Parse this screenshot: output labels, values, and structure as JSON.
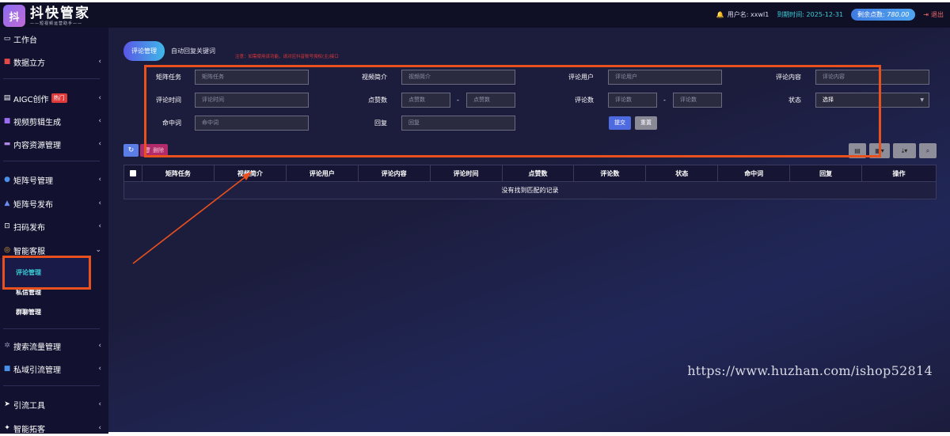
{
  "app": {
    "logo_mark": "抖",
    "title": "抖快管家",
    "subtitle": "——短视频运营助手——"
  },
  "header": {
    "bell_icon": "bell-icon",
    "user_label": "用户名: xxwl1",
    "expire_label": "到期时间: 2025-12-31",
    "points_label": "剩余点数:",
    "points_value": "780.00",
    "logout_label": "退出",
    "colors": {
      "expire": "#39d0d8",
      "logout": "#f06a6a",
      "points_bg": "#3f7be0"
    }
  },
  "sidebar": {
    "items": [
      {
        "label": "工作台",
        "icon": "monitor-icon"
      },
      {
        "label": "数据立方",
        "icon": "chart-icon"
      },
      {
        "label": "AIGC创作",
        "icon": "ai-icon",
        "badge": "热门"
      },
      {
        "label": "视频剪辑生成",
        "icon": "video-icon"
      },
      {
        "label": "内容资源管理",
        "icon": "folder-icon"
      },
      {
        "label": "矩阵号管理",
        "icon": "matrix-icon"
      },
      {
        "label": "矩阵号发布",
        "icon": "send-icon"
      },
      {
        "label": "扫码发布",
        "icon": "qrcode-icon"
      },
      {
        "label": "智能客服",
        "icon": "robot-icon"
      },
      {
        "label": "搜索流量管理",
        "icon": "search-traffic-icon"
      },
      {
        "label": "私域引流管理",
        "icon": "traffic-icon"
      },
      {
        "label": "引流工具",
        "icon": "tool-icon"
      },
      {
        "label": "智能拓客",
        "icon": "expand-icon"
      }
    ],
    "subitems": [
      {
        "label": "评论管理",
        "active": true
      },
      {
        "label": "私信管理"
      },
      {
        "label": "群聊管理"
      }
    ]
  },
  "main": {
    "tabs": [
      {
        "label": "评论管理",
        "active": true
      },
      {
        "label": "自动回复关键词"
      }
    ],
    "notice": "注意：如需使用该功能，请对应抖音账号授权(主)接口",
    "form": {
      "task_label": "矩阵任务",
      "task_placeholder": "矩阵任务",
      "video_label": "视频简介",
      "video_placeholder": "视频简介",
      "user_label": "评论用户",
      "user_placeholder": "评论用户",
      "content_label": "评论内容",
      "content_placeholder": "评论内容",
      "time_label": "评论时间",
      "time_placeholder": "评论时间",
      "likes_label": "点赞数",
      "likes_placeholder": "点赞数",
      "comments_label": "评论数",
      "comments_placeholder": "评论数",
      "status_label": "状态",
      "status_value": "选择",
      "hit_label": "命中词",
      "hit_placeholder": "命中词",
      "reply_label": "回复",
      "reply_placeholder": "回复",
      "range_sep": "-",
      "submit_label": "提交",
      "reset_label": "重置"
    },
    "toolbar": {
      "refresh_icon": "refresh-icon",
      "delete_label": "删除",
      "view_icon": "list-view-icon",
      "columns_icon": "columns-icon",
      "export_icon": "export-icon",
      "search_icon": "search-icon"
    },
    "table": {
      "columns": [
        "矩阵任务",
        "视频简介",
        "评论用户",
        "评论内容",
        "评论时间",
        "点赞数",
        "评论数",
        "状态",
        "命中词",
        "回复",
        "操作"
      ],
      "empty_text": "没有找到匹配的记录"
    }
  },
  "watermark": "https://www.huzhan.com/ishop52814",
  "annotation": {
    "color": "#e8501e"
  }
}
